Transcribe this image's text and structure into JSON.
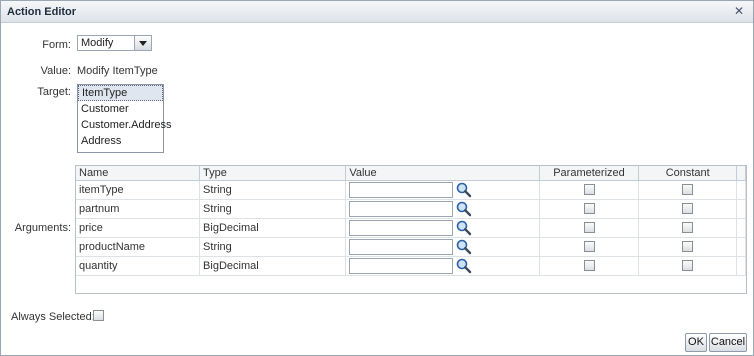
{
  "dialog": {
    "title": "Action Editor",
    "close_icon": "close-icon"
  },
  "form": {
    "label": "Form:",
    "value": "Modify"
  },
  "value_row": {
    "label": "Value:",
    "text": "Modify ItemType"
  },
  "target": {
    "label": "Target:",
    "options": [
      "ItemType",
      "Customer",
      "Customer.Address",
      "Address"
    ],
    "selected": "ItemType"
  },
  "arguments": {
    "label": "Arguments:",
    "columns": [
      "Name",
      "Type",
      "Value",
      "Parameterized",
      "Constant"
    ],
    "rows": [
      {
        "name": "itemType",
        "type": "String"
      },
      {
        "name": "partnum",
        "type": "String"
      },
      {
        "name": "price",
        "type": "BigDecimal"
      },
      {
        "name": "productName",
        "type": "String"
      },
      {
        "name": "quantity",
        "type": "BigDecimal"
      }
    ]
  },
  "always_selected": {
    "label": "Always Selected:"
  },
  "buttons": {
    "ok": "OK",
    "cancel": "Cancel"
  }
}
